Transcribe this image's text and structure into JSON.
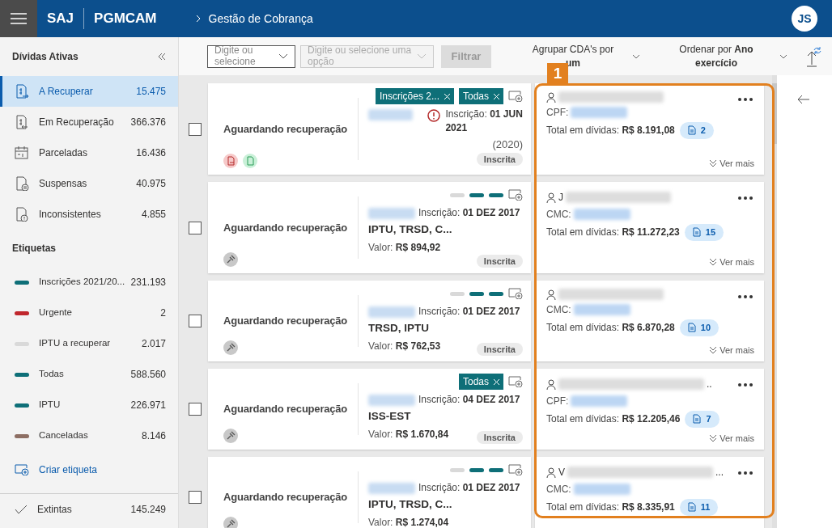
{
  "header": {
    "brand": "SAJ",
    "module": "PGMCAM",
    "breadcrumb": "Gestão de Cobrança",
    "avatar": "JS"
  },
  "sidebar": {
    "title": "Dívidas Ativas",
    "items": [
      {
        "label": "A Recuperar",
        "count": "15.475",
        "selected": true
      },
      {
        "label": "Em Recuperação",
        "count": "366.376",
        "selected": false
      },
      {
        "label": "Parceladas",
        "count": "16.436",
        "selected": false
      },
      {
        "label": "Suspensas",
        "count": "40.975",
        "selected": false
      },
      {
        "label": "Inconsistentes",
        "count": "4.855",
        "selected": false
      }
    ],
    "labels_title": "Etiquetas",
    "labels": [
      {
        "label": "Inscrições 2021/20...",
        "count": "231.193",
        "color": "#0e6f78"
      },
      {
        "label": "Urgente",
        "count": "2",
        "color": "#c0272d"
      },
      {
        "label": "IPTU a recuperar",
        "count": "2.017",
        "color": "#d9d9d9"
      },
      {
        "label": "Todas",
        "count": "588.560",
        "color": "#0e6f78"
      },
      {
        "label": "IPTU",
        "count": "226.971",
        "color": "#0e6f78"
      },
      {
        "label": "Canceladas",
        "count": "8.146",
        "color": "#8d6e63"
      }
    ],
    "create_label": "Criar etiqueta",
    "footer_item": {
      "label": "Extintas",
      "count": "145.249"
    }
  },
  "toolbar": {
    "field_1": {
      "placeholder": "Digite ou selecione",
      "disabled": false
    },
    "field_2": {
      "placeholder": "Digite ou selecione uma opção",
      "disabled": true
    },
    "filter_button": "Filtrar",
    "group_label": "Agrupar CDA's por",
    "group_value": "um",
    "sort_label": "Ordenar por **Ano exercício**"
  },
  "annotation": {
    "label": "1"
  },
  "cards": [
    {
      "checked": false,
      "status": "Aguardando recuperação",
      "tags": [
        {
          "kind": "chip",
          "label": "Inscrições 2...",
          "color": "#0e6f78"
        },
        {
          "kind": "chip",
          "label": "Todas",
          "color": "#0e6f78"
        }
      ],
      "warning": true,
      "inscricao_label": "Inscrição:",
      "inscricao_date": "01 JUN 2021",
      "year": "(2020)",
      "state": "Inscrita",
      "doc_label": "CPF:",
      "total_label": "Total em dívidas:",
      "total_value": "R$ 8.191,08",
      "cda_count": "2",
      "more": "Ver mais"
    },
    {
      "checked": false,
      "status": "Aguardando recuperação",
      "tags": [
        {
          "kind": "dash",
          "color": "#d9d9d9"
        },
        {
          "kind": "dash",
          "color": "#0e6f78"
        },
        {
          "kind": "dash",
          "color": "#0e6f78"
        }
      ],
      "warning": false,
      "inscricao_label": "Inscrição:",
      "inscricao_date": "01 DEZ 2017",
      "description": "IPTU, TRSD, C...",
      "valor_label": "Valor:",
      "valor": "R$ 894,92",
      "state": "Inscrita",
      "name_start": "J",
      "doc_label": "CMC:",
      "total_label": "Total em dívidas:",
      "total_value": "R$ 11.272,23",
      "cda_count": "15",
      "more": "Ver mais"
    },
    {
      "checked": false,
      "status": "Aguardando recuperação",
      "tags": [
        {
          "kind": "dash",
          "color": "#d9d9d9"
        },
        {
          "kind": "dash",
          "color": "#0e6f78"
        },
        {
          "kind": "dash",
          "color": "#0e6f78"
        }
      ],
      "warning": false,
      "inscricao_label": "Inscrição:",
      "inscricao_date": "01 DEZ 2017",
      "description": "TRSD, IPTU",
      "valor_label": "Valor:",
      "valor": "R$ 762,53",
      "state": "Inscrita",
      "doc_label": "CMC:",
      "total_label": "Total em dívidas:",
      "total_value": "R$ 6.870,28",
      "cda_count": "10",
      "more": "Ver mais"
    },
    {
      "checked": false,
      "status": "Aguardando recuperação",
      "tags": [
        {
          "kind": "chip",
          "label": "Todas",
          "color": "#0e6f78"
        }
      ],
      "warning": false,
      "inscricao_label": "Inscrição:",
      "inscricao_date": "04 DEZ 2017",
      "description": "ISS-EST",
      "valor_label": "Valor:",
      "valor": "R$ 1.670,84",
      "state": "Inscrita",
      "name_end": "..",
      "doc_label": "CPF:",
      "total_label": "Total em dívidas:",
      "total_value": "R$ 12.205,46",
      "cda_count": "7",
      "more": "Ver mais"
    },
    {
      "checked": false,
      "status": "Aguardando recuperação",
      "tags": [
        {
          "kind": "dash",
          "color": "#d9d9d9"
        },
        {
          "kind": "dash",
          "color": "#0e6f78"
        },
        {
          "kind": "dash",
          "color": "#0e6f78"
        }
      ],
      "warning": false,
      "inscricao_label": "Inscrição:",
      "inscricao_date": "01 DEZ 2017",
      "description": "IPTU, TRSD, C...",
      "valor_label": "Valor:",
      "valor": "R$ 1.274,04",
      "name_start": "V",
      "name_end": "...",
      "doc_label": "CMC:",
      "total_label": "Total em dívidas:",
      "total_value": "R$ 8.335,91",
      "cda_count": "11"
    }
  ]
}
